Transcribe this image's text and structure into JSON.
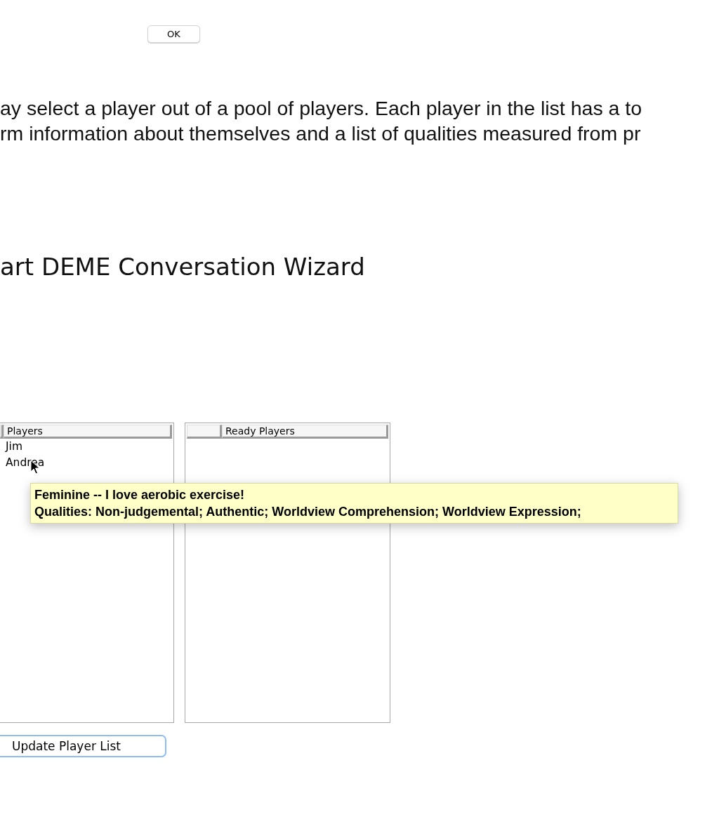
{
  "ok_button": "OK",
  "description": [
    "ay select a player out of a pool of players. Each player in the list has a to",
    "rm information about themselves and a list of qualities measured from pr"
  ],
  "heading": "art DEME Conversation Wizard",
  "players_table": {
    "column": "Players",
    "rows": [
      "Jim",
      "Andrea"
    ]
  },
  "ready_table": {
    "column": "Ready Players"
  },
  "tooltip": {
    "lines": [
      "Feminine -- I love aerobic exercise!",
      "Qualities: Non-judgemental; Authentic; Worldview Comprehension; Worldview Expression;"
    ]
  },
  "update_button": "Update Player List"
}
